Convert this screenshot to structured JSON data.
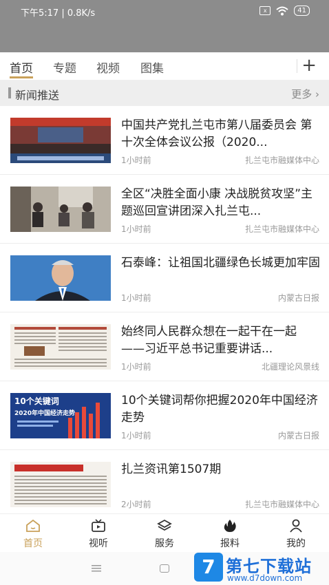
{
  "status": {
    "time_text": "下午5:17 | 0.8K/s",
    "battery": "41",
    "sim_label": "x"
  },
  "tabs": {
    "items": [
      "首页",
      "专题",
      "视频",
      "图集"
    ],
    "add_label": "+"
  },
  "section": {
    "title": "新闻推送",
    "more": "更多"
  },
  "news": [
    {
      "title": "中国共产党扎兰屯市第八届委员会 第十次全体会议公报（2020...",
      "time": "1小时前",
      "source": "扎兰屯市融媒体中心",
      "thumb": "meeting-photo"
    },
    {
      "title": "全区“决胜全面小康 决战脱贫攻坚”主题巡回宣讲团深入扎兰屯...",
      "time": "1小时前",
      "source": "扎兰屯市融媒体中心",
      "thumb": "room-meeting-photo"
    },
    {
      "title": "石泰峰：让祖国北疆绿色长城更加牢固",
      "time": "1小时前",
      "source": "内蒙古日报",
      "thumb": "portrait-photo"
    },
    {
      "title": "始终同人民群众想在一起干在一起 ——习近平总书记重要讲话...",
      "time": "1小时前",
      "source": "北疆理论风景线",
      "thumb": "newspaper-photo"
    },
    {
      "title": "10个关键词帮你把握2020年中国经济走势",
      "time": "1小时前",
      "source": "内蒙古日报",
      "thumb": "infographic-photo"
    },
    {
      "title": "扎兰资讯第1507期",
      "time": "2小时前",
      "source": "扎兰屯市融媒体中心",
      "thumb": "newsletter-photo"
    }
  ],
  "thumb_texts": {
    "keyword_title": "10个关键词",
    "keyword_sub": "2020年中国经济走势"
  },
  "nav": [
    {
      "label": "首页",
      "icon": "home-icon"
    },
    {
      "label": "视听",
      "icon": "tv-icon"
    },
    {
      "label": "服务",
      "icon": "layers-icon"
    },
    {
      "label": "报料",
      "icon": "flame-icon"
    },
    {
      "label": "我的",
      "icon": "user-icon"
    }
  ],
  "watermark": {
    "logo": "7",
    "title": "第七下载站",
    "url": "www.d7down.com"
  },
  "colors": {
    "accent": "#c9a15a",
    "status_bar": "#8c8c8c",
    "section_bg": "#eeeeee",
    "watermark_blue": "#1e6fd8"
  }
}
